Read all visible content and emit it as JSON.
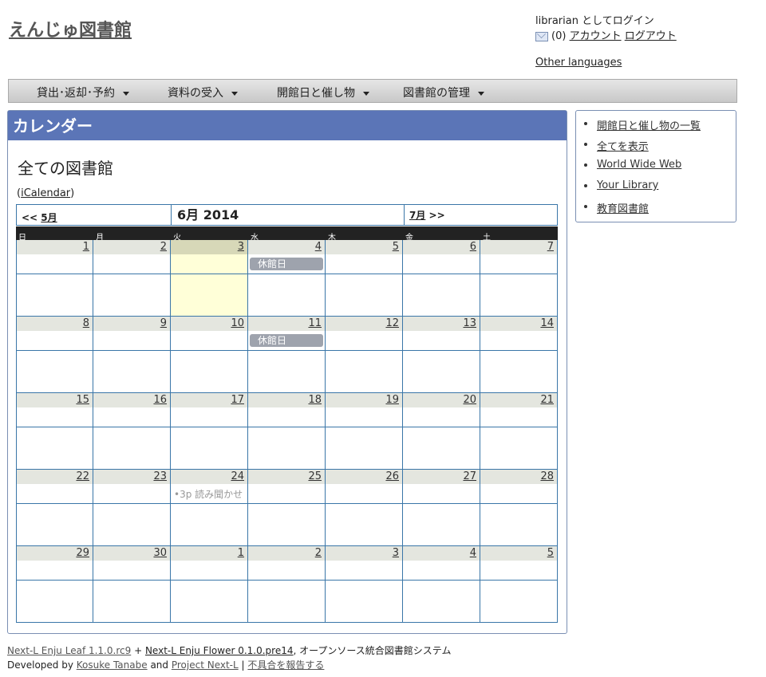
{
  "site": {
    "title": "えんじゅ図書館"
  },
  "user": {
    "name_line": "librarian としてログイン",
    "message_count": "(0)",
    "account_label": "アカウント",
    "logout_label": "ログアウト"
  },
  "other_languages": "Other languages",
  "menu": [
    {
      "label": "貸出･返却･予約"
    },
    {
      "label": "資料の受入"
    },
    {
      "label": "開館日と催し物"
    },
    {
      "label": "図書館の管理"
    }
  ],
  "main": {
    "heading": "カレンダー",
    "subtitle": "全ての図書館",
    "ical_label": "iCalendar",
    "ical_open": "(",
    "ical_close": ")"
  },
  "calendar": {
    "prev_arrow": "<<",
    "prev_month": "5月",
    "title": "6月 2014",
    "next_month": "7月",
    "next_arrow": ">>",
    "weekdays": [
      "日",
      "月",
      "火",
      "水",
      "木",
      "金",
      "土"
    ],
    "weeks": [
      [
        "1",
        "2",
        "3",
        "4",
        "5",
        "6",
        "7"
      ],
      [
        "8",
        "9",
        "10",
        "11",
        "12",
        "13",
        "14"
      ],
      [
        "15",
        "16",
        "17",
        "18",
        "19",
        "20",
        "21"
      ],
      [
        "22",
        "23",
        "24",
        "25",
        "26",
        "27",
        "28"
      ],
      [
        "29",
        "30",
        "1",
        "2",
        "3",
        "4",
        "5"
      ]
    ],
    "events": {
      "closed_1": "休館日",
      "closed_2": "休館日",
      "story": "•3p 読み聞かせ"
    }
  },
  "sidebar": {
    "items": [
      "開館日と催し物の一覧",
      "全てを表示",
      "World Wide Web",
      "Your Library",
      "教育図書館"
    ]
  },
  "footer": {
    "leaf": "Next-L Enju Leaf 1.1.0.rc9",
    "plus": "+",
    "flower": "Next-L Enju Flower 0.1.0.pre14",
    "system": ", オープンソース統合図書館システム",
    "developed_by": "Developed by",
    "author": "Kosuke Tanabe",
    "and": "and",
    "project": "Project Next-L",
    "sep": "|",
    "report": "不具合を報告する"
  }
}
